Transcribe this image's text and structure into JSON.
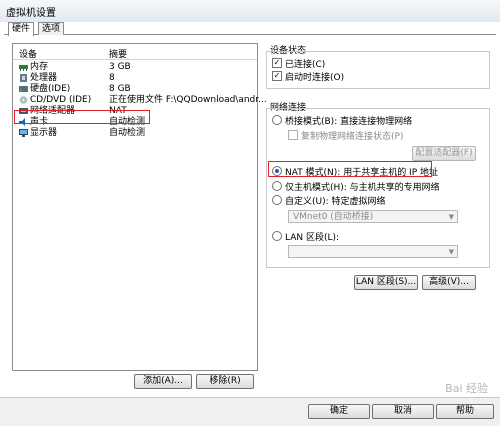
{
  "window": {
    "title": "虚拟机设置"
  },
  "tabs": [
    {
      "label": "硬件"
    },
    {
      "label": "选项"
    }
  ],
  "device_list": {
    "header": {
      "device": "设备",
      "summary": "摘要"
    },
    "items": [
      {
        "name": "内存",
        "summary": "3 GB",
        "icon": "memory-icon"
      },
      {
        "name": "处理器",
        "summary": "8",
        "icon": "cpu-icon"
      },
      {
        "name": "硬盘(IDE)",
        "summary": "8 GB",
        "icon": "hard-disk-icon"
      },
      {
        "name": "CD/DVD (IDE)",
        "summary": "正在使用文件 F:\\QQDownload\\andr...",
        "icon": "cd-dvd-icon"
      },
      {
        "name": "网络适配器",
        "summary": "NAT",
        "icon": "network-adapter-icon"
      },
      {
        "name": "声卡",
        "summary": "自动检测",
        "icon": "sound-card-icon"
      },
      {
        "name": "显示器",
        "summary": "自动检测",
        "icon": "display-icon"
      }
    ],
    "add_button": "添加(A)...",
    "remove_button": "移除(R)"
  },
  "device_status": {
    "title": "设备状态",
    "connected": {
      "label": "已连接(C)",
      "checked": true
    },
    "connect_at_power_on": {
      "label": "启动时连接(O)",
      "checked": true
    }
  },
  "network_connection": {
    "title": "网络连接",
    "bridged": {
      "label": "桥接模式(B): 直接连接物理网络",
      "selected": false
    },
    "replicate": {
      "label": "复制物理网络连接状态(P)",
      "checked": false
    },
    "configure_adapter_button": "配置适配器(F)",
    "nat": {
      "label": "NAT 模式(N): 用于共享主机的 IP 地址",
      "selected": true
    },
    "host_only": {
      "label": "仅主机模式(H): 与主机共享的专用网络",
      "selected": false
    },
    "custom": {
      "label": "自定义(U): 特定虚拟网络",
      "selected": false
    },
    "vmnet_select": "VMnet0 (自动桥接)",
    "lan_segment": {
      "label": "LAN 区段(L):",
      "selected": false
    },
    "lan_select": ""
  },
  "lan_segments_button": "LAN 区段(S)...",
  "advanced_button": "高级(V)...",
  "footer": {
    "ok": "确定",
    "cancel": "取消",
    "help": "帮助"
  },
  "watermark": "Bai 经验"
}
